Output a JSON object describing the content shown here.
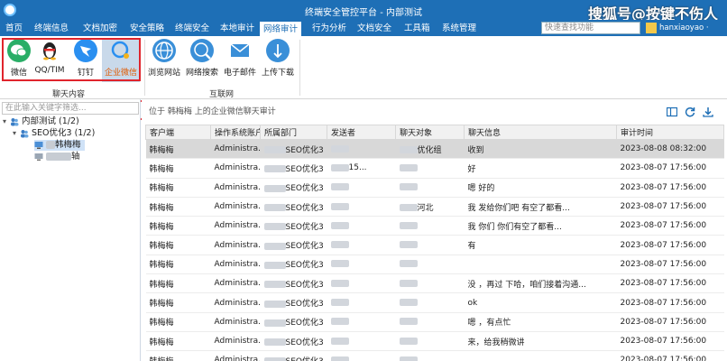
{
  "window": {
    "title": "终端安全管控平台 - 内部测试",
    "watermark": "搜狐号@按键不伤人"
  },
  "menu": {
    "tabs": [
      "首页",
      "终端信息",
      "文档加密",
      "安全策略",
      "终端安全",
      "本地审计",
      "网络审计",
      "行为分析",
      "文档安全",
      "工具箱",
      "系统管理"
    ],
    "active_index": 6,
    "search_placeholder": "快速查找功能",
    "user": "hanxiaoyao ·"
  },
  "ribbon": {
    "chat_group": {
      "label": "聊天内容",
      "items": [
        "微信",
        "QQ/TIM",
        "钉钉",
        "企业微信"
      ]
    },
    "web_group": {
      "label": "互联网",
      "items": [
        "浏览网站",
        "网络搜索",
        "电子邮件",
        "上传下载"
      ]
    }
  },
  "tree": {
    "search_placeholder": "在此输入关键字筛选...",
    "root": "内部测试 (1/2)",
    "group": "SEO优化3 (1/2)",
    "child1": "韩梅梅",
    "child2": "轴"
  },
  "content": {
    "location": "位于 韩梅梅 上的企业微信聊天审计",
    "columns": [
      "客户端",
      "操作系统账户",
      "所属部门",
      "发送者",
      "聊天对象",
      "聊天信息",
      "审计时间"
    ],
    "rows": [
      {
        "client": "韩梅梅",
        "os": "Administra...",
        "dept": "SEO优化3",
        "sender": "",
        "target": "优化组",
        "msg": "收到",
        "time": "2023-08-08 08:32:00"
      },
      {
        "client": "韩梅梅",
        "os": "Administra...",
        "dept": "SEO优化3",
        "sender": "15...",
        "target": "",
        "msg": "好",
        "time": "2023-08-07 17:56:00"
      },
      {
        "client": "韩梅梅",
        "os": "Administra...",
        "dept": "SEO优化3",
        "sender": "",
        "target": "",
        "msg": "嗯 好的",
        "time": "2023-08-07 17:56:00"
      },
      {
        "client": "韩梅梅",
        "os": "Administra...",
        "dept": "SEO优化3",
        "sender": "",
        "target": "河北",
        "msg": "我 发给你们吧 有空了都看...",
        "time": "2023-08-07 17:56:00"
      },
      {
        "client": "韩梅梅",
        "os": "Administra...",
        "dept": "SEO优化3",
        "sender": "",
        "target": "",
        "msg": "我 你们 你们有空了都看...",
        "time": "2023-08-07 17:56:00"
      },
      {
        "client": "韩梅梅",
        "os": "Administra...",
        "dept": "SEO优化3",
        "sender": "",
        "target": "",
        "msg": "有",
        "time": "2023-08-07 17:56:00"
      },
      {
        "client": "韩梅梅",
        "os": "Administra...",
        "dept": "SEO优化3",
        "sender": "",
        "target": "",
        "msg": "",
        "time": "2023-08-07 17:56:00"
      },
      {
        "client": "韩梅梅",
        "os": "Administra...",
        "dept": "SEO优化3",
        "sender": "",
        "target": "",
        "msg": "没 ，再过 下哈，咱们接着沟通...",
        "time": "2023-08-07 17:56:00"
      },
      {
        "client": "韩梅梅",
        "os": "Administra...",
        "dept": "SEO优化3",
        "sender": "",
        "target": "",
        "msg": "ok",
        "time": "2023-08-07 17:56:00"
      },
      {
        "client": "韩梅梅",
        "os": "Administra...",
        "dept": "SEO优化3",
        "sender": "",
        "target": "",
        "msg": "嗯 ，有点忙",
        "time": "2023-08-07 17:56:00"
      },
      {
        "client": "韩梅梅",
        "os": "Administra...",
        "dept": "SEO优化3",
        "sender": "",
        "target": "",
        "msg": "来，给我稍微讲",
        "time": "2023-08-07 17:56:00"
      },
      {
        "client": "韩梅梅",
        "os": "Administra...",
        "dept": "SEO优化3",
        "sender": "",
        "target": "",
        "msg": "",
        "time": "2023-08-07 17:56:00"
      }
    ]
  },
  "colors": {
    "titlebar": "#1e6fb6",
    "highlight": "#e0242c",
    "selected_row": "#d8d8d8"
  }
}
